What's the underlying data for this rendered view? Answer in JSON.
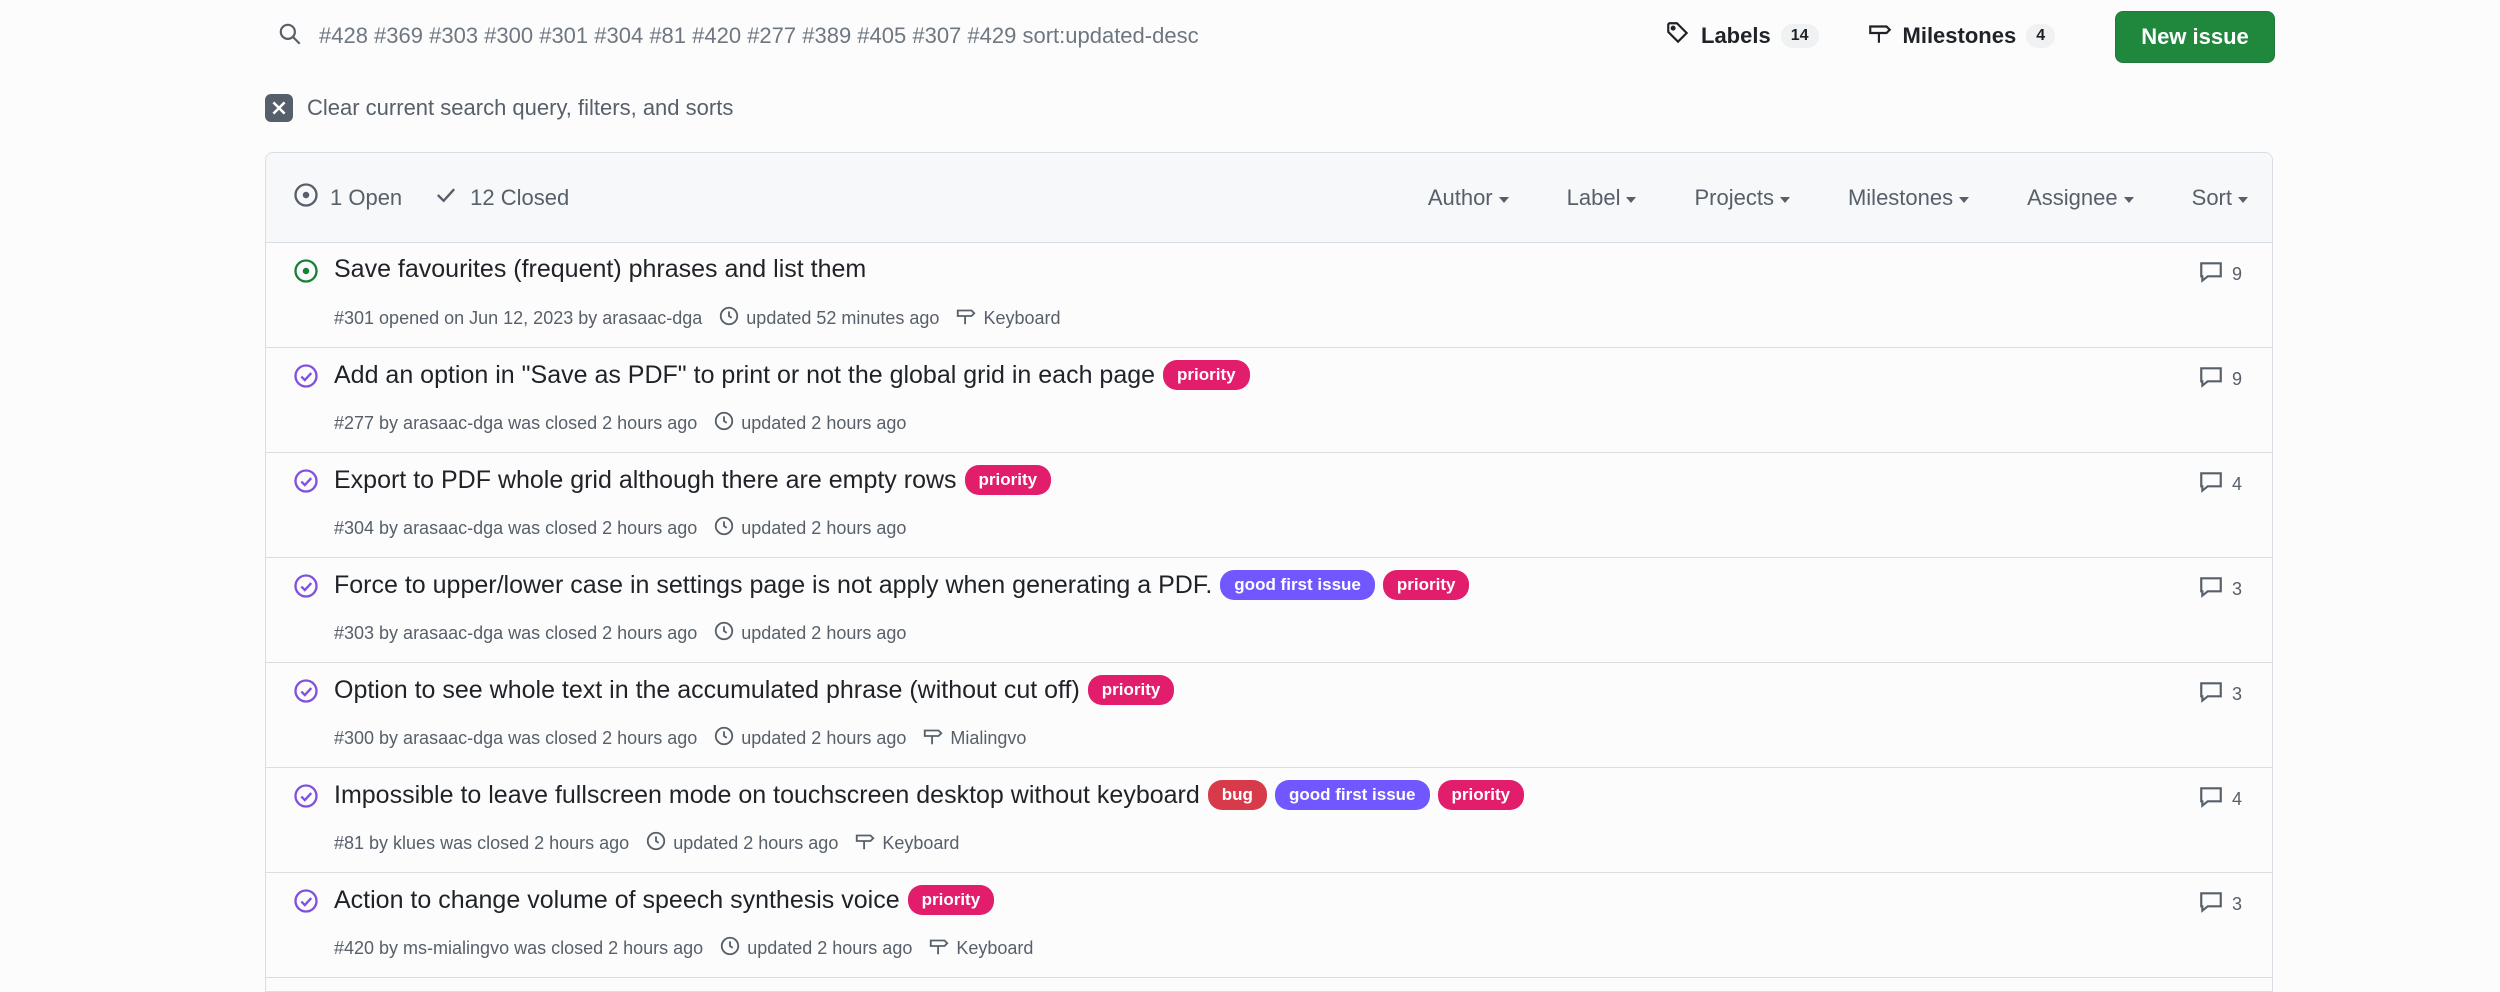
{
  "search": {
    "query": "#428 #369 #303 #300 #301 #304 #81 #420 #277 #389 #405 #307 #429 sort:updated-desc"
  },
  "nav": {
    "labels_label": "Labels",
    "labels_count": "14",
    "milestones_label": "Milestones",
    "milestones_count": "4",
    "new_issue_label": "New issue"
  },
  "clear_filters": {
    "text": "Clear current search query, filters, and sorts"
  },
  "header": {
    "open_label": "1 Open",
    "closed_label": "12 Closed",
    "filters": [
      "Author",
      "Label",
      "Projects",
      "Milestones",
      "Assignee",
      "Sort"
    ]
  },
  "colors": {
    "open_icon": "#1a7f37",
    "closed_icon": "#8250df",
    "priority": "#e11d6c",
    "good_first_issue": "#7057ff",
    "bug": "#d73a4a",
    "new_issue_button": "#1f883d"
  },
  "issues": [
    {
      "state": "open",
      "title": "Save favourites (frequent) phrases and list them",
      "labels": [],
      "meta_main": "#301 opened on Jun 12, 2023 by arasaac-dga",
      "updated": "updated 52 minutes ago",
      "milestone": "Keyboard",
      "comments": "9"
    },
    {
      "state": "closed",
      "title": "Add an option in \"Save as PDF\" to print or not the global grid in each page",
      "labels": [
        {
          "name": "priority",
          "kind": "priority"
        }
      ],
      "meta_main": "#277 by arasaac-dga was closed 2 hours ago",
      "updated": "updated 2 hours ago",
      "milestone": "",
      "comments": "9"
    },
    {
      "state": "closed",
      "title": "Export to PDF whole grid although there are empty rows",
      "labels": [
        {
          "name": "priority",
          "kind": "priority"
        }
      ],
      "meta_main": "#304 by arasaac-dga was closed 2 hours ago",
      "updated": "updated 2 hours ago",
      "milestone": "",
      "comments": "4"
    },
    {
      "state": "closed",
      "title": "Force to upper/lower case in settings page is not apply when generating a PDF.",
      "labels": [
        {
          "name": "good first issue",
          "kind": "gfi"
        },
        {
          "name": "priority",
          "kind": "priority"
        }
      ],
      "meta_main": "#303 by arasaac-dga was closed 2 hours ago",
      "updated": "updated 2 hours ago",
      "milestone": "",
      "comments": "3"
    },
    {
      "state": "closed",
      "title": "Option to see whole text in the accumulated phrase (without cut off)",
      "labels": [
        {
          "name": "priority",
          "kind": "priority"
        }
      ],
      "meta_main": "#300 by arasaac-dga was closed 2 hours ago",
      "updated": "updated 2 hours ago",
      "milestone": "Mialingvo",
      "comments": "3"
    },
    {
      "state": "closed",
      "title": "Impossible to leave fullscreen mode on touchscreen desktop without keyboard",
      "labels": [
        {
          "name": "bug",
          "kind": "bug"
        },
        {
          "name": "good first issue",
          "kind": "gfi"
        },
        {
          "name": "priority",
          "kind": "priority"
        }
      ],
      "meta_main": "#81 by klues was closed 2 hours ago",
      "updated": "updated 2 hours ago",
      "milestone": "Keyboard",
      "comments": "4"
    },
    {
      "state": "closed",
      "title": "Action to change volume of speech synthesis voice",
      "labels": [
        {
          "name": "priority",
          "kind": "priority"
        }
      ],
      "meta_main": "#420 by ms-mialingvo was closed 2 hours ago",
      "updated": "updated 2 hours ago",
      "milestone": "Keyboard",
      "comments": "3"
    }
  ]
}
